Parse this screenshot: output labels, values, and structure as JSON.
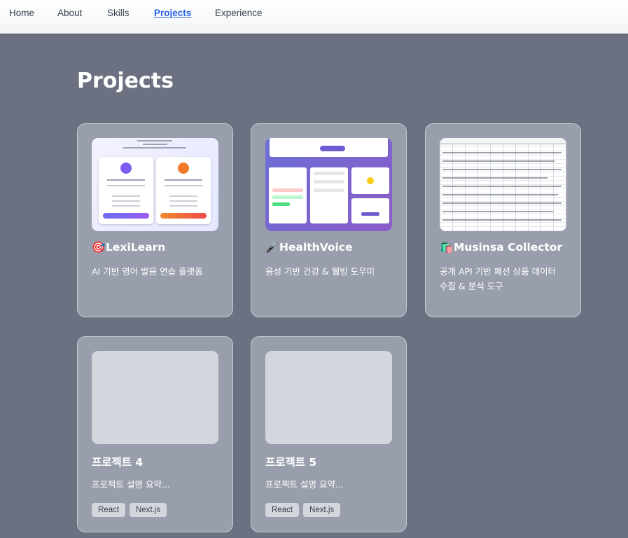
{
  "nav": {
    "items": [
      {
        "label": "Home",
        "active": false
      },
      {
        "label": "About",
        "active": false
      },
      {
        "label": "Skills",
        "active": false
      },
      {
        "label": "Projects",
        "active": true
      },
      {
        "label": "Experience",
        "active": false
      }
    ]
  },
  "page": {
    "title": "Projects"
  },
  "projects": [
    {
      "icon": "🎯",
      "icon_name": "target-icon",
      "title": "LexiLearn",
      "desc": "AI 기반 영어 발음 연습 플랫폼",
      "tags": []
    },
    {
      "icon": "🎤",
      "icon_name": "microphone-icon",
      "title": "HealthVoice",
      "desc": "음성 기반 건강 & 웰빙 도우미",
      "tags": []
    },
    {
      "icon": "🛍️",
      "icon_name": "shopping-bags-icon",
      "title": "Musinsa Collector",
      "desc": "공개 API 기반 패션 상품 데이터 수집 & 분석 도구",
      "tags": []
    },
    {
      "icon": "",
      "title": "프로젝트 4",
      "desc": "프로젝트 설명 요약...",
      "tags": [
        "React",
        "Next.js"
      ]
    },
    {
      "icon": "",
      "title": "프로젝트 5",
      "desc": "프로젝트 설명 요약...",
      "tags": [
        "React",
        "Next.js"
      ]
    }
  ],
  "colors": {
    "background": "#6b7180",
    "card": "#989eab",
    "nav_active": "#2563eb",
    "tag_bg": "#d3d6dd"
  }
}
